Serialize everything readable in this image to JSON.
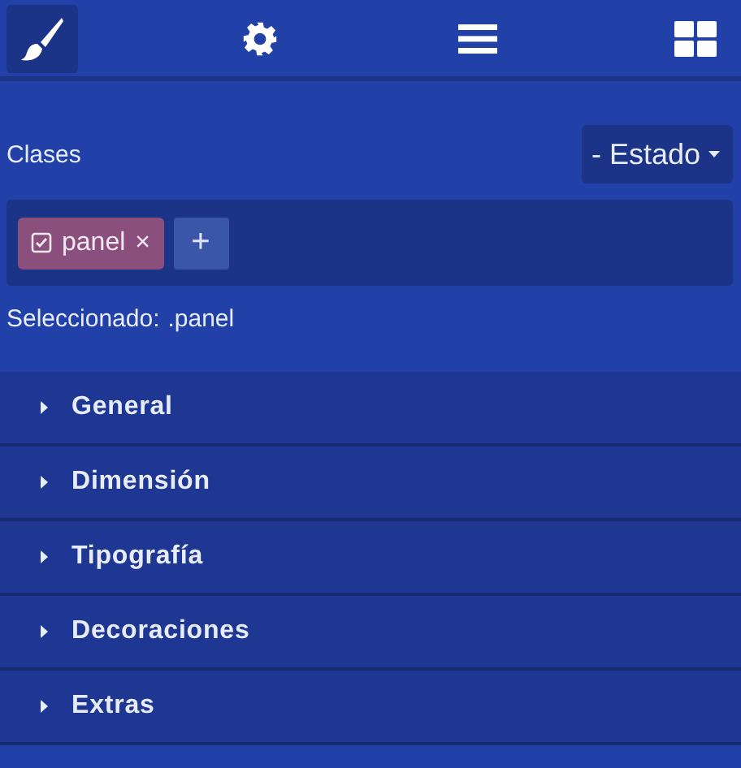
{
  "tools": [
    {
      "kind": "brush",
      "selected": true
    },
    {
      "kind": "gear",
      "selected": false
    },
    {
      "kind": "menu",
      "selected": false
    },
    {
      "kind": "grid",
      "selected": false
    }
  ],
  "classes": {
    "label": "Clases",
    "state_button": "- Estado",
    "tags": [
      {
        "name": "panel",
        "checked": true,
        "remove": "×"
      }
    ],
    "add_button": "+",
    "selected_label": "Seleccionado:",
    "selected_value": ".panel"
  },
  "sectors": [
    {
      "title": "General",
      "expanded": false
    },
    {
      "title": "Dimensión",
      "expanded": false
    },
    {
      "title": "Tipografía",
      "expanded": false
    },
    {
      "title": "Decoraciones",
      "expanded": false
    },
    {
      "title": "Extras",
      "expanded": false
    }
  ]
}
